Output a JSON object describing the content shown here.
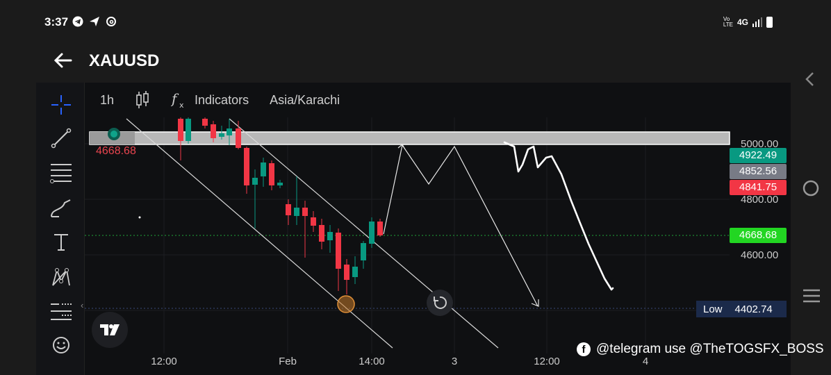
{
  "status": {
    "time": "3:37",
    "network": "4G"
  },
  "header": {
    "title": "XAUUSD"
  },
  "toolbar": {
    "interval": "1h",
    "indicators": "Indicators",
    "timezone": "Asia/Karachi"
  },
  "chart": {
    "last_price_left": "4668.68",
    "price_axis": [
      "5000.00",
      "4800.00",
      "4600.00"
    ],
    "boxes": {
      "high": {
        "value": "4922.49",
        "color": "#089981"
      },
      "mid": {
        "value": "4852.56",
        "color": "#787b86"
      },
      "low_red": {
        "value": "4841.75",
        "color": "#f23645"
      },
      "current": {
        "value": "4668.68",
        "color": "#22d622"
      }
    },
    "low_label": "Low",
    "low_value": "4402.74",
    "time_axis": [
      "12:00",
      "Feb",
      "14:00",
      "3",
      "12:00",
      "4"
    ]
  },
  "watermark": "@telegram use @TheTOGSFX_BOSS"
}
